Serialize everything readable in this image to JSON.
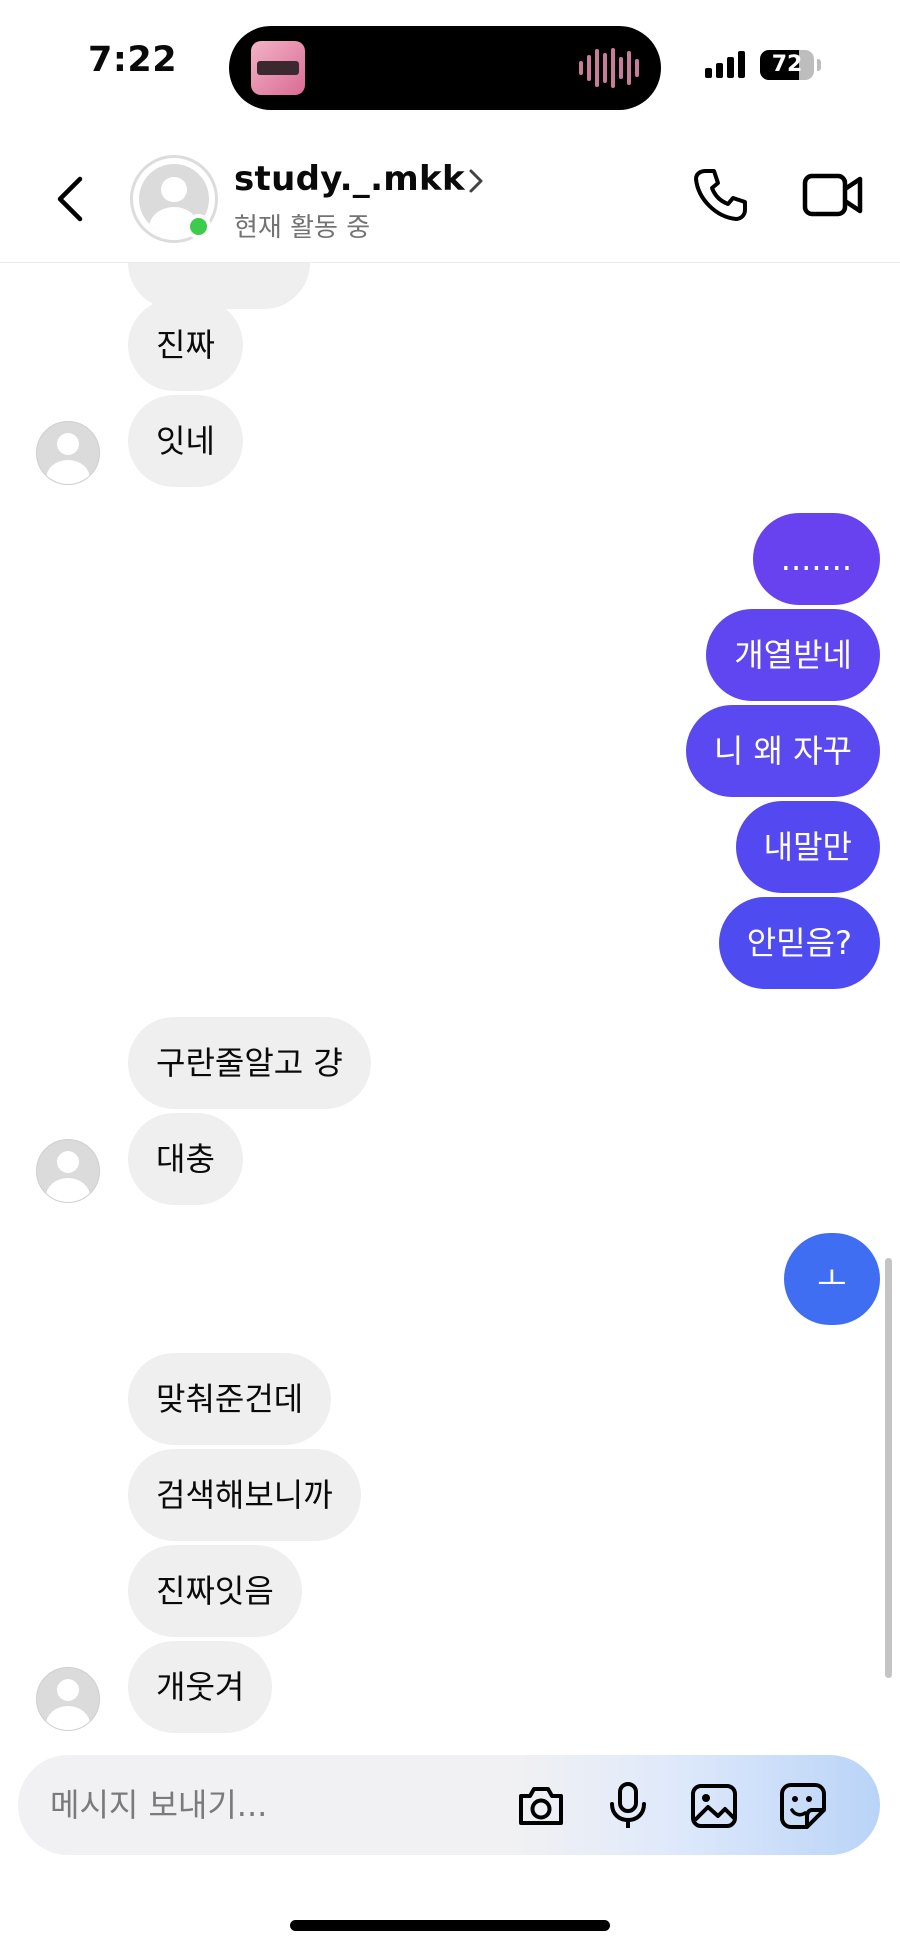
{
  "status_bar": {
    "time": "7:22",
    "battery": "72",
    "battery_level": 0.72
  },
  "header": {
    "contact_name": "study._.mkk",
    "contact_status": "현재 활동 중",
    "online_color": "#3ccb4a"
  },
  "colors": {
    "incoming_bubble": "#efeff0",
    "outgoing_top": "#6842ef",
    "outgoing_mid": "#5a48f0",
    "outgoing_bottom": "#3f6ef2"
  },
  "messages": [
    {
      "text": "진짜",
      "direction": "in"
    },
    {
      "text": "잇네",
      "direction": "in",
      "avatar": true
    },
    {
      "text": ".......",
      "direction": "out"
    },
    {
      "text": "개열받네",
      "direction": "out"
    },
    {
      "text": "니 왜 자꾸",
      "direction": "out"
    },
    {
      "text": "내말만",
      "direction": "out"
    },
    {
      "text": "안믿음?",
      "direction": "out"
    },
    {
      "text": "구란줄알고 걍",
      "direction": "in"
    },
    {
      "text": "대충",
      "direction": "in",
      "avatar": true
    },
    {
      "text": "ㅗ",
      "direction": "out"
    },
    {
      "text": "맞춰준건데",
      "direction": "in"
    },
    {
      "text": "검색해보니까",
      "direction": "in"
    },
    {
      "text": "진짜잇음",
      "direction": "in"
    },
    {
      "text": "개웃겨",
      "direction": "in",
      "avatar": true
    }
  ],
  "composer": {
    "placeholder": "메시지 보내기...",
    "icons": [
      "camera-icon",
      "microphone-icon",
      "gallery-icon",
      "sticker-icon"
    ]
  }
}
